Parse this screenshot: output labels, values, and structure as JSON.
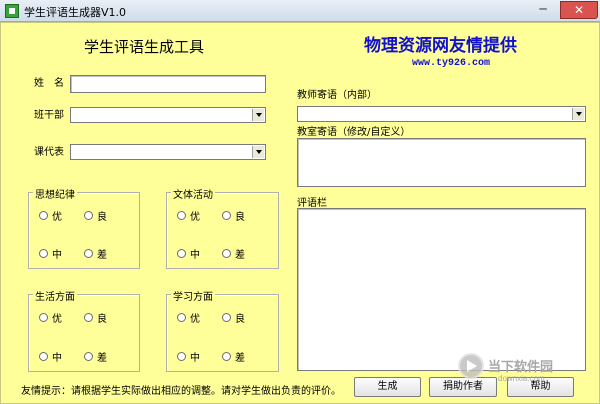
{
  "window": {
    "title": "学生评语生成器V1.0",
    "min_label": "─",
    "close_label": "✕"
  },
  "header": {
    "heading": "学生评语生成工具",
    "brand": "物理资源网友情提供",
    "brand_url": "www.ty926.com"
  },
  "form": {
    "name_label": "姓　名",
    "cadre_label": "班干部",
    "course_label": "课代表",
    "teacher_label": "教师寄语（内部）",
    "classroom_label": "教室寄语（修改/自定义）",
    "comment_label": "评语栏"
  },
  "groups": {
    "thought": "思想纪律",
    "culture": "文体活动",
    "life": "生活方面",
    "study": "学习方面",
    "options": [
      "优",
      "良",
      "中",
      "差"
    ]
  },
  "footer": {
    "tip": "友情提示：请根据学生实际做出相应的调整。请对学生做出负责的评价。",
    "generate": "生成",
    "donate": "捐助作者",
    "help": "帮助"
  },
  "watermark": {
    "text": "当下软件园",
    "sub": "downxia.com"
  }
}
